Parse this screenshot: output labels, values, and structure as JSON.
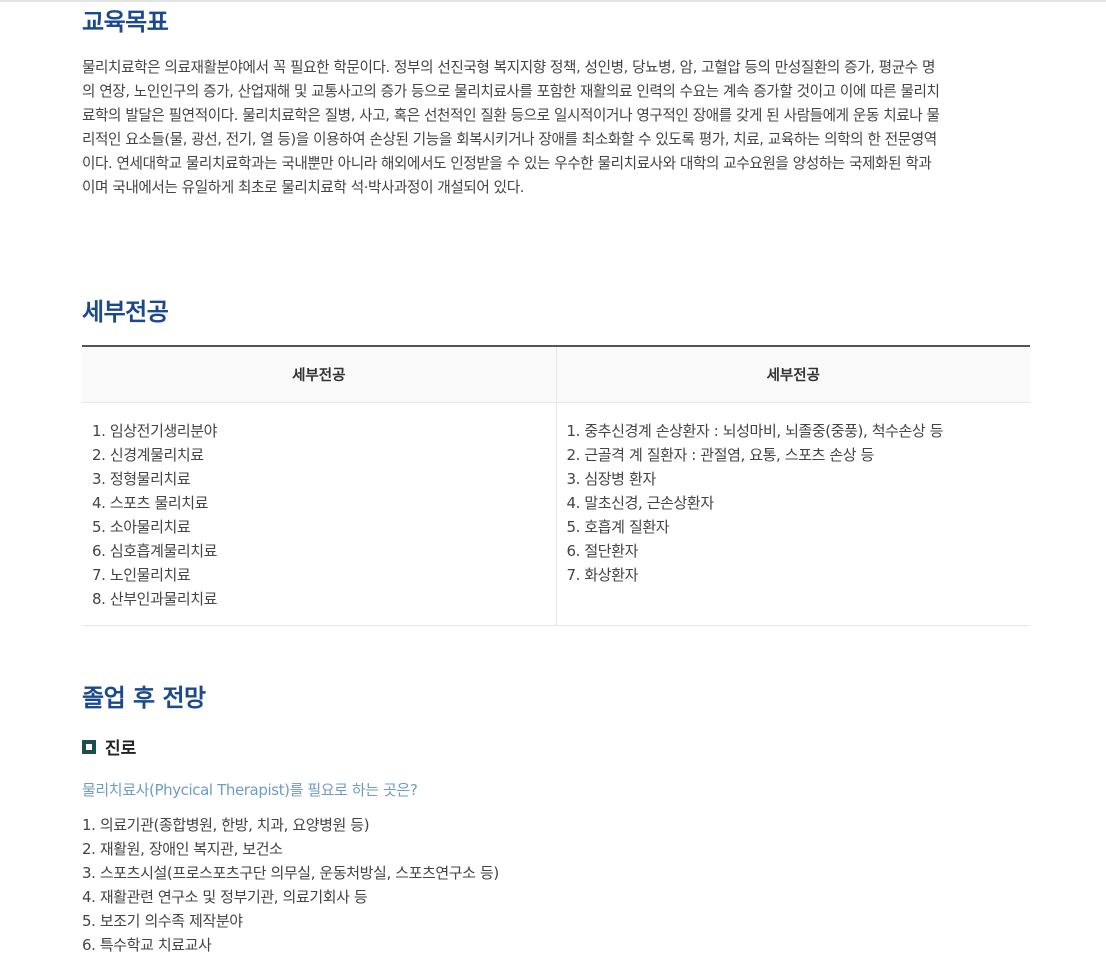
{
  "edu_goal": {
    "title": "교육목표",
    "lines": [
      "물리치료학은 의료재활분야에서 꼭 필요한 학문이다. 정부의 선진국형 복지지향 정책, 성인병, 당뇨병, 암, 고혈압 등의 만성질환의 증가, 평균수 명",
      "의 연장, 노인인구의 증가, 산업재해 및 교통사고의 증가 등으로 물리치료사를 포함한 재활의료 인력의 수요는 계속 증가할 것이고 이에 따른 물리치",
      "료학의 발달은 필연적이다. 물리치료학은 질병, 사고, 혹은 선천적인 질환 등으로 일시적이거나 영구적인 장애를 갖게 된 사람들에게 운동 치료나 물",
      "리적인 요소들(물, 광선, 전기, 열 등)을 이용하여 손상된 기능을 회복시키거나 장애를 최소화할 수 있도록 평가, 치료, 교육하는 의학의 한 전문영역",
      "이다. 연세대학교 물리치료학과는 국내뿐만 아니라 해외에서도 인정받을 수 있는 우수한 물리치료사와 대학의 교수요원을 양성하는 국제화된 학과",
      "이며 국내에서는 유일하게 최초로 물리치료학 석·박사과정이 개설되어 있다."
    ]
  },
  "majors": {
    "title": "세부전공",
    "headers": [
      "세부전공",
      "세부전공"
    ],
    "left": [
      "1. 임상전기생리분야",
      "2. 신경계물리치료",
      "3. 정형물리치료",
      "4. 스포츠 물리치료",
      "5. 소아물리치료",
      "6. 심호흡계물리치료",
      "7. 노인물리치료",
      "8. 산부인과물리치료"
    ],
    "right": [
      "1. 중추신경계 손상환자 : 뇌성마비, 뇌졸중(중풍), 척수손상 등",
      "2. 근골격 계 질환자 : 관절염, 요통, 스포츠 손상 등",
      "3. 심장병 환자",
      "4. 말초신경, 근손상환자",
      "5. 호흡계 질환자",
      "6. 절단환자",
      "7. 화상환자"
    ]
  },
  "career": {
    "title": "졸업 후 전망",
    "sub_title": "진로",
    "lead": "물리치료사(Phycical Therapist)를 필요로 하는 곳은?",
    "items": [
      "1. 의료기관(종합병원, 한방, 치과, 요양병원 등)",
      "2. 재활원, 장애인 복지관, 보건소",
      "3. 스포츠시설(프로스포츠구단 의무실, 운동처방실, 스포츠연구소 등)",
      "4. 재활관련 연구소 및 정부기관, 의료기회사 등",
      "5. 보조기 의수족 제작분야",
      "6. 특수학교 치료교사"
    ]
  }
}
